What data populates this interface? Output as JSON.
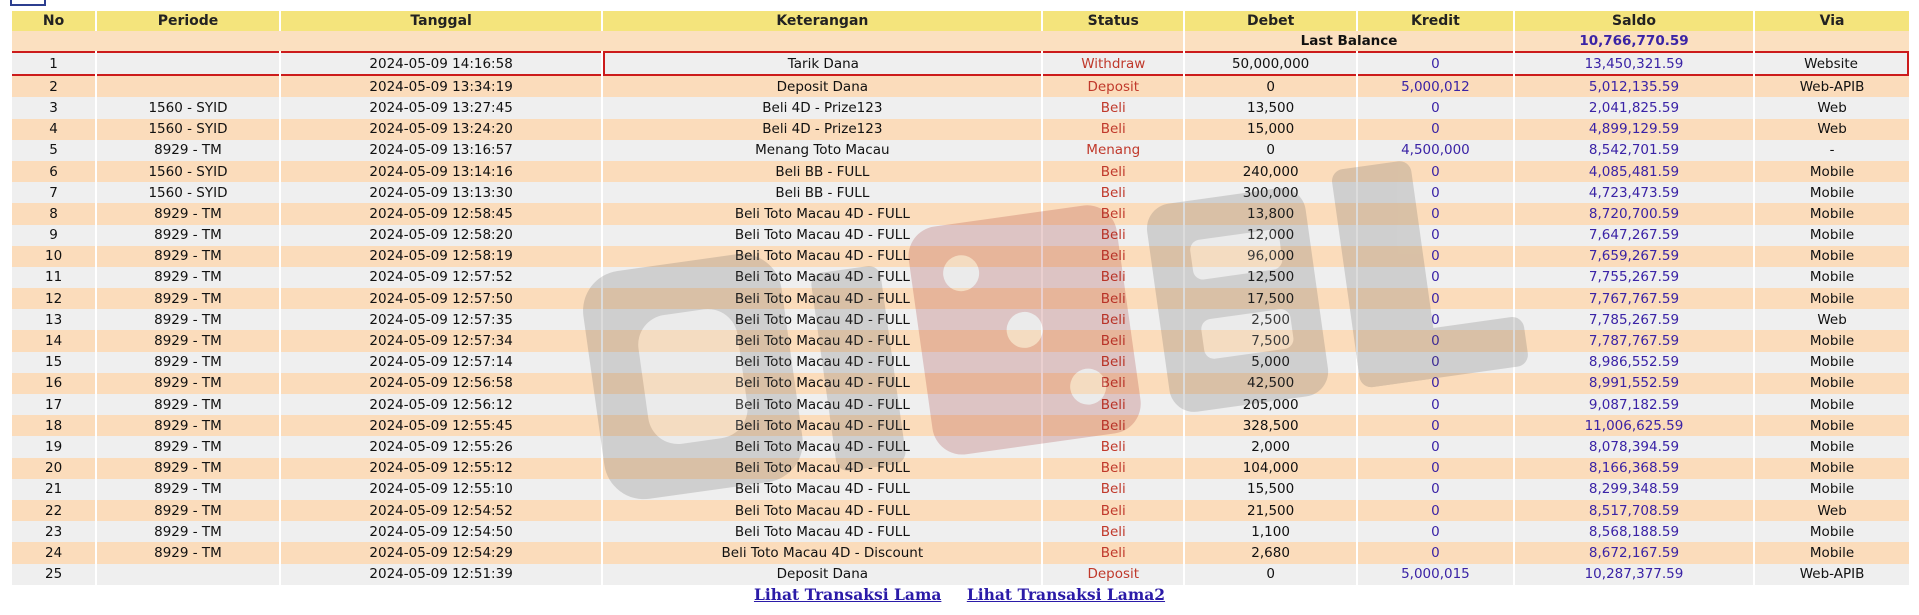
{
  "table": {
    "headers": {
      "no": "No",
      "periode": "Periode",
      "tanggal": "Tanggal",
      "keterangan": "Keterangan",
      "status": "Status",
      "debet": "Debet",
      "kredit": "Kredit",
      "saldo": "Saldo",
      "via": "Via"
    },
    "last_balance": {
      "label": "Last Balance",
      "value": "10,766,770.59"
    },
    "rows": [
      {
        "no": "1",
        "periode": "",
        "tanggal": "2024-05-09 14:16:58",
        "keterangan": "Tarik Dana",
        "status": "Withdraw",
        "debet": "50,000,000",
        "kredit": "0",
        "saldo": "13,450,321.59",
        "via": "Website"
      },
      {
        "no": "2",
        "periode": "",
        "tanggal": "2024-05-09 13:34:19",
        "keterangan": "Deposit Dana",
        "status": "Deposit",
        "debet": "0",
        "kredit": "5,000,012",
        "saldo": "5,012,135.59",
        "via": "Web-APIB"
      },
      {
        "no": "3",
        "periode": "1560 - SYID",
        "tanggal": "2024-05-09 13:27:45",
        "keterangan": "Beli 4D - Prize123",
        "status": "Beli",
        "debet": "13,500",
        "kredit": "0",
        "saldo": "2,041,825.59",
        "via": "Web"
      },
      {
        "no": "4",
        "periode": "1560 - SYID",
        "tanggal": "2024-05-09 13:24:20",
        "keterangan": "Beli 4D - Prize123",
        "status": "Beli",
        "debet": "15,000",
        "kredit": "0",
        "saldo": "4,899,129.59",
        "via": "Web"
      },
      {
        "no": "5",
        "periode": "8929 - TM",
        "tanggal": "2024-05-09 13:16:57",
        "keterangan": "Menang Toto Macau",
        "status": "Menang",
        "debet": "0",
        "kredit": "4,500,000",
        "saldo": "8,542,701.59",
        "via": "-"
      },
      {
        "no": "6",
        "periode": "1560 - SYID",
        "tanggal": "2024-05-09 13:14:16",
        "keterangan": "Beli BB - FULL",
        "status": "Beli",
        "debet": "240,000",
        "kredit": "0",
        "saldo": "4,085,481.59",
        "via": "Mobile"
      },
      {
        "no": "7",
        "periode": "1560 - SYID",
        "tanggal": "2024-05-09 13:13:30",
        "keterangan": "Beli BB - FULL",
        "status": "Beli",
        "debet": "300,000",
        "kredit": "0",
        "saldo": "4,723,473.59",
        "via": "Mobile"
      },
      {
        "no": "8",
        "periode": "8929 - TM",
        "tanggal": "2024-05-09 12:58:45",
        "keterangan": "Beli Toto Macau 4D - FULL",
        "status": "Beli",
        "debet": "13,800",
        "kredit": "0",
        "saldo": "8,720,700.59",
        "via": "Mobile"
      },
      {
        "no": "9",
        "periode": "8929 - TM",
        "tanggal": "2024-05-09 12:58:20",
        "keterangan": "Beli Toto Macau 4D - FULL",
        "status": "Beli",
        "debet": "12,000",
        "kredit": "0",
        "saldo": "7,647,267.59",
        "via": "Mobile"
      },
      {
        "no": "10",
        "periode": "8929 - TM",
        "tanggal": "2024-05-09 12:58:19",
        "keterangan": "Beli Toto Macau 4D - FULL",
        "status": "Beli",
        "debet": "96,000",
        "kredit": "0",
        "saldo": "7,659,267.59",
        "via": "Mobile"
      },
      {
        "no": "11",
        "periode": "8929 - TM",
        "tanggal": "2024-05-09 12:57:52",
        "keterangan": "Beli Toto Macau 4D - FULL",
        "status": "Beli",
        "debet": "12,500",
        "kredit": "0",
        "saldo": "7,755,267.59",
        "via": "Mobile"
      },
      {
        "no": "12",
        "periode": "8929 - TM",
        "tanggal": "2024-05-09 12:57:50",
        "keterangan": "Beli Toto Macau 4D - FULL",
        "status": "Beli",
        "debet": "17,500",
        "kredit": "0",
        "saldo": "7,767,767.59",
        "via": "Mobile"
      },
      {
        "no": "13",
        "periode": "8929 - TM",
        "tanggal": "2024-05-09 12:57:35",
        "keterangan": "Beli Toto Macau 4D - FULL",
        "status": "Beli",
        "debet": "2,500",
        "kredit": "0",
        "saldo": "7,785,267.59",
        "via": "Web"
      },
      {
        "no": "14",
        "periode": "8929 - TM",
        "tanggal": "2024-05-09 12:57:34",
        "keterangan": "Beli Toto Macau 4D - FULL",
        "status": "Beli",
        "debet": "7,500",
        "kredit": "0",
        "saldo": "7,787,767.59",
        "via": "Mobile"
      },
      {
        "no": "15",
        "periode": "8929 - TM",
        "tanggal": "2024-05-09 12:57:14",
        "keterangan": "Beli Toto Macau 4D - FULL",
        "status": "Beli",
        "debet": "5,000",
        "kredit": "0",
        "saldo": "8,986,552.59",
        "via": "Mobile"
      },
      {
        "no": "16",
        "periode": "8929 - TM",
        "tanggal": "2024-05-09 12:56:58",
        "keterangan": "Beli Toto Macau 4D - FULL",
        "status": "Beli",
        "debet": "42,500",
        "kredit": "0",
        "saldo": "8,991,552.59",
        "via": "Mobile"
      },
      {
        "no": "17",
        "periode": "8929 - TM",
        "tanggal": "2024-05-09 12:56:12",
        "keterangan": "Beli Toto Macau 4D - FULL",
        "status": "Beli",
        "debet": "205,000",
        "kredit": "0",
        "saldo": "9,087,182.59",
        "via": "Mobile"
      },
      {
        "no": "18",
        "periode": "8929 - TM",
        "tanggal": "2024-05-09 12:55:45",
        "keterangan": "Beli Toto Macau 4D - FULL",
        "status": "Beli",
        "debet": "328,500",
        "kredit": "0",
        "saldo": "11,006,625.59",
        "via": "Mobile"
      },
      {
        "no": "19",
        "periode": "8929 - TM",
        "tanggal": "2024-05-09 12:55:26",
        "keterangan": "Beli Toto Macau 4D - FULL",
        "status": "Beli",
        "debet": "2,000",
        "kredit": "0",
        "saldo": "8,078,394.59",
        "via": "Mobile"
      },
      {
        "no": "20",
        "periode": "8929 - TM",
        "tanggal": "2024-05-09 12:55:12",
        "keterangan": "Beli Toto Macau 4D - FULL",
        "status": "Beli",
        "debet": "104,000",
        "kredit": "0",
        "saldo": "8,166,368.59",
        "via": "Mobile"
      },
      {
        "no": "21",
        "periode": "8929 - TM",
        "tanggal": "2024-05-09 12:55:10",
        "keterangan": "Beli Toto Macau 4D - FULL",
        "status": "Beli",
        "debet": "15,500",
        "kredit": "0",
        "saldo": "8,299,348.59",
        "via": "Mobile"
      },
      {
        "no": "22",
        "periode": "8929 - TM",
        "tanggal": "2024-05-09 12:54:52",
        "keterangan": "Beli Toto Macau 4D - FULL",
        "status": "Beli",
        "debet": "21,500",
        "kredit": "0",
        "saldo": "8,517,708.59",
        "via": "Web"
      },
      {
        "no": "23",
        "periode": "8929 - TM",
        "tanggal": "2024-05-09 12:54:50",
        "keterangan": "Beli Toto Macau 4D - FULL",
        "status": "Beli",
        "debet": "1,100",
        "kredit": "0",
        "saldo": "8,568,188.59",
        "via": "Mobile"
      },
      {
        "no": "24",
        "periode": "8929 - TM",
        "tanggal": "2024-05-09 12:54:29",
        "keterangan": "Beli Toto Macau 4D - Discount",
        "status": "Beli",
        "debet": "2,680",
        "kredit": "0",
        "saldo": "8,672,167.59",
        "via": "Mobile"
      },
      {
        "no": "25",
        "periode": "",
        "tanggal": "2024-05-09 12:51:39",
        "keterangan": "Deposit Dana",
        "status": "Deposit",
        "debet": "0",
        "kredit": "5,000,015",
        "saldo": "10,287,377.59",
        "via": "Web-APIB"
      }
    ]
  },
  "footer": {
    "link1": "Lihat Transaksi Lama",
    "link2": "Lihat Transaksi Lama2"
  },
  "colors": {
    "header_bg": "#f4e47c",
    "row_odd": "#efefef",
    "row_even": "#fbdcbb",
    "status_red": "#c0392b",
    "link_blue": "#2b1ba8",
    "highlight": "#cc1b1b"
  }
}
